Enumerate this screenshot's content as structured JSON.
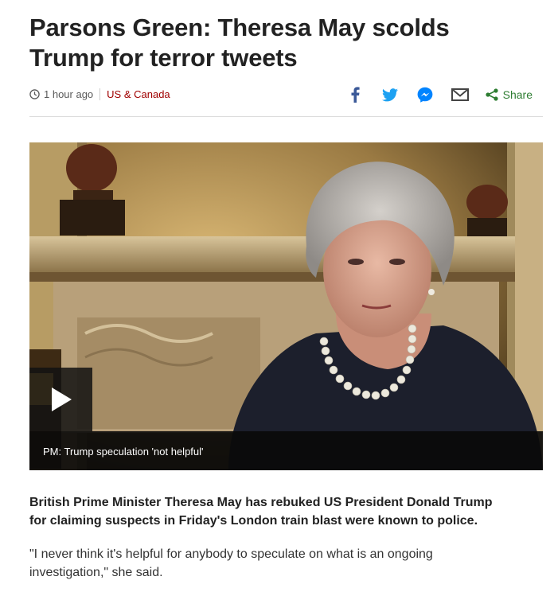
{
  "article": {
    "headline": "Parsons Green: Theresa May scolds Trump for terror tweets",
    "timestamp": "1 hour ago",
    "section": "US & Canada",
    "lead": "British Prime Minister Theresa May has rebuked US President Donald Trump for claiming suspects in Friday's London train blast were known to police.",
    "paragraph_1": "\"I never think it's helpful for anybody to speculate on what is an ongoing investigation,\" she said."
  },
  "share": {
    "label": "Share",
    "icons": [
      "facebook-icon",
      "twitter-icon",
      "messenger-icon",
      "email-icon",
      "share-icon"
    ]
  },
  "media": {
    "caption": "PM: Trump speculation 'not helpful'",
    "play_icon": "play-icon"
  },
  "colors": {
    "section": "#a00000",
    "facebook": "#3b5998",
    "twitter": "#1da1f2",
    "messenger": "#0084ff",
    "email": "#444444",
    "share": "#2e7d32"
  }
}
